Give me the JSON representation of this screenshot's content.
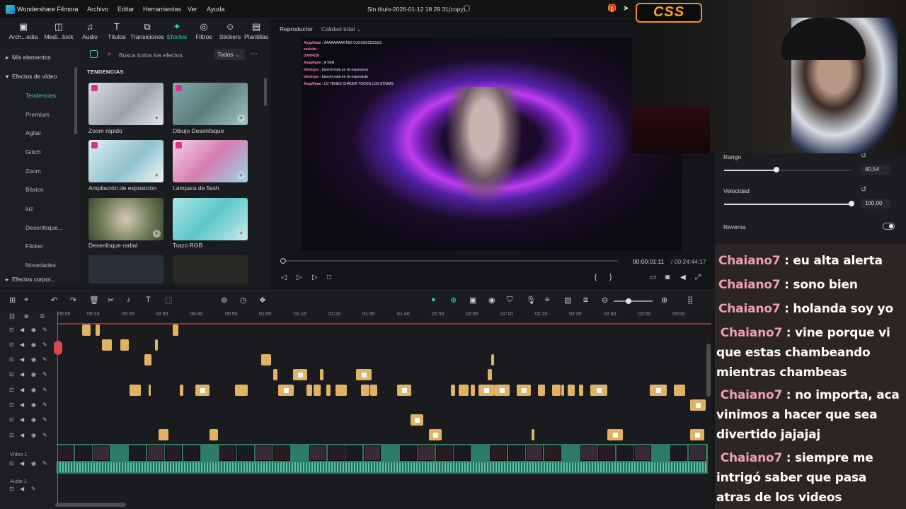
{
  "app": {
    "name": "Wondershare Filmora",
    "document_title": "Sin título-2026-01-12 18 29 31(copy)"
  },
  "menu": [
    "Archivo",
    "Editar",
    "Herramientas",
    "Ver",
    "Ayuda"
  ],
  "toolbar": [
    {
      "label": "Arch...edia",
      "icon": "folder-icon"
    },
    {
      "label": "Medi...tock",
      "icon": "stock-media-icon"
    },
    {
      "label": "Audio",
      "icon": "music-note-icon"
    },
    {
      "label": "Títulos",
      "icon": "text-t-icon"
    },
    {
      "label": "Transiciones",
      "icon": "transition-icon"
    },
    {
      "label": "Efectos",
      "icon": "sparkle-icon",
      "active": true
    },
    {
      "label": "Filtros",
      "icon": "filter-icon"
    },
    {
      "label": "Stickers",
      "icon": "sticker-icon"
    },
    {
      "label": "Plantillas",
      "icon": "template-icon"
    }
  ],
  "sidebar": {
    "my_effects": "Mis elementos",
    "video_effects": "Efectos de vídeo",
    "items": [
      "Tendencias",
      "Premium",
      "Agitar",
      "Glitch",
      "Zoom",
      "Básico",
      "luz",
      "Desenfoque...",
      "Flicker",
      "Novedades"
    ],
    "active": "Tendencias",
    "body_effects": "Efectos corpor..."
  },
  "effects": {
    "search_placeholder": "Busca todos los efectos",
    "filter": "Todos",
    "section": "TENDENCIAS",
    "cards": [
      "Zoom rápido",
      "Dibujo Desenfoque",
      "Ampliación de exposición",
      "Lámpara de flash",
      "Desenfoque radial",
      "Trazo RGB"
    ]
  },
  "player": {
    "tab": "Reproductor",
    "quality": "Calidad total",
    "current_time": "00:00:01:11",
    "total_time": "/ 00:24:44:17",
    "overlay_chat": [
      {
        "user": "AsapRami :",
        "text": "AAAAAAAAA MIS OJOSSSSSSSSS"
      },
      {
        "user": "ezeleito :",
        "text": ""
      },
      {
        "user": "DAKRON :",
        "text": ""
      },
      {
        "user": "AsapRami :",
        "text": "A VER"
      },
      {
        "user": "timotopo :",
        "text": "bianchi esta en dx esperanza"
      },
      {
        "user": "timotopo :",
        "text": "bianchi esta en dx esperando"
      },
      {
        "user": "AsapRami :",
        "text": "LO TENES CHACER TODOS LOS STRIMS"
      }
    ]
  },
  "properties": {
    "range_label": "Rango",
    "range_value": "40,54",
    "range_level": 0.41,
    "speed_label": "Velocidad",
    "speed_value": "100,00",
    "speed_level": 1.0,
    "reverse_label": "Reversa",
    "reverse_on": false
  },
  "stream": {
    "logo": "CSS"
  },
  "chat": [
    {
      "user": "Chaiano7",
      "text": "eu alta alerta"
    },
    {
      "user": "Chaiano7",
      "text": "sono bien"
    },
    {
      "user": "Chaiano7",
      "text": "holanda soy yo"
    },
    {
      "user": "Chaiano7",
      "text": "vine porque vi que estas chambeando mientras chambeas"
    },
    {
      "user": "Chaiano7",
      "text": "no importa, aca vinimos a hacer que sea divertido jajajaj"
    },
    {
      "user": "Chaiano7",
      "text": "siempre me intrigó saber que pasa atras de los videos"
    }
  ],
  "timeline": {
    "ruler": [
      "00:00",
      "00:10",
      "00:20",
      "00:30",
      "00:40",
      "00:50",
      "01:00",
      "01:10",
      "01:20",
      "01:30",
      "01:40",
      "01:50",
      "02:00",
      "02:10",
      "02:20",
      "02:30",
      "02:40",
      "02:50",
      "03:00"
    ],
    "video_track": "Vídeo 1",
    "audio_track": "Audio 1"
  },
  "colors": {
    "accent": "#33d0a8",
    "clip": "#e0b264",
    "playhead": "#d94a4d",
    "video_track": "#2f7c66"
  }
}
